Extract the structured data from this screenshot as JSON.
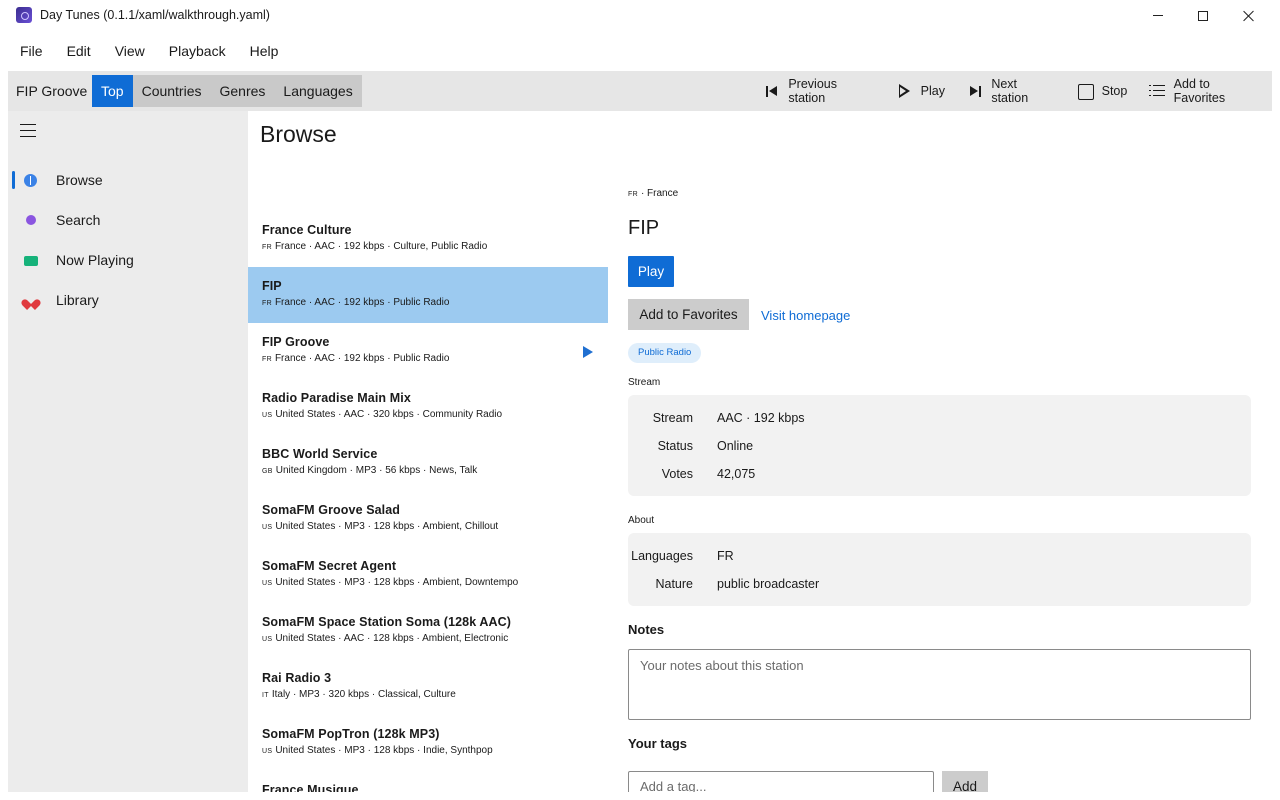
{
  "window": {
    "title": "Day Tunes (0.1.1/xaml/walkthrough.yaml)"
  },
  "menu": [
    "File",
    "Edit",
    "View",
    "Playback",
    "Help"
  ],
  "toolbar": {
    "current_station": "FIP Groove",
    "tabs": [
      {
        "label": "Top",
        "active": true
      },
      {
        "label": "Countries",
        "active": false
      },
      {
        "label": "Genres",
        "active": false
      },
      {
        "label": "Languages",
        "active": false
      }
    ],
    "actions": {
      "previous": "Previous station",
      "play": "Play",
      "next": "Next station",
      "stop": "Stop",
      "add_favorites": "Add to Favorites"
    }
  },
  "sidebar": {
    "items": [
      {
        "label": "Browse",
        "icon": "browse-icon",
        "selected": true
      },
      {
        "label": "Search",
        "icon": "search-icon",
        "selected": false
      },
      {
        "label": "Now Playing",
        "icon": "now-playing-icon",
        "selected": false
      },
      {
        "label": "Library",
        "icon": "heart-icon",
        "selected": false
      }
    ]
  },
  "main": {
    "title": "Browse"
  },
  "stations": [
    {
      "name": "France Culture",
      "cc": "FR",
      "meta": "France · AAC · 192 kbps · Culture, Public Radio"
    },
    {
      "name": "FIP",
      "cc": "FR",
      "meta": "France · AAC · 192 kbps · Public Radio"
    },
    {
      "name": "FIP Groove",
      "cc": "FR",
      "meta": "France · AAC · 192 kbps · Public Radio"
    },
    {
      "name": "Radio Paradise Main Mix",
      "cc": "US",
      "meta": "United States · AAC · 320 kbps · Community Radio"
    },
    {
      "name": "BBC World Service",
      "cc": "GB",
      "meta": "United Kingdom · MP3 · 56 kbps · News, Talk"
    },
    {
      "name": "SomaFM Groove Salad",
      "cc": "US",
      "meta": "United States · MP3 · 128 kbps · Ambient, Chillout"
    },
    {
      "name": "SomaFM Secret Agent",
      "cc": "US",
      "meta": "United States · MP3 · 128 kbps · Ambient, Downtempo"
    },
    {
      "name": "SomaFM Space Station Soma (128k AAC)",
      "cc": "US",
      "meta": "United States · AAC · 128 kbps · Ambient, Electronic"
    },
    {
      "name": "Rai Radio 3",
      "cc": "IT",
      "meta": "Italy · MP3 · 320 kbps · Classical, Culture"
    },
    {
      "name": "SomaFM PopTron (128k MP3)",
      "cc": "US",
      "meta": "United States · MP3 · 128 kbps · Indie, Synthpop"
    },
    {
      "name": "France Musique",
      "cc": "",
      "meta": ""
    }
  ],
  "detail": {
    "country_code": "FR",
    "country": "France",
    "name": "FIP",
    "play_label": "Play",
    "favorites_label": "Add to Favorites",
    "homepage_label": "Visit homepage",
    "tag": "Public Radio",
    "stream_section": "Stream",
    "stream": [
      {
        "key": "Stream",
        "value": "AAC · 192 kbps"
      },
      {
        "key": "Status",
        "value": "Online"
      },
      {
        "key": "Votes",
        "value": "42,075"
      }
    ],
    "about_section": "About",
    "about": [
      {
        "key": "Languages",
        "value": "FR"
      },
      {
        "key": "Nature",
        "value": "public broadcaster"
      }
    ],
    "notes_label": "Notes",
    "notes_placeholder": "Your notes about this station",
    "tags_label": "Your tags",
    "tag_placeholder": "Add a tag...",
    "add_label": "Add"
  },
  "colors": {
    "accent": "#0f6cd5",
    "selected_row": "#9ccaf0",
    "sidebar_bg": "#ececec",
    "toolbar_bg": "#e6e6e6"
  }
}
